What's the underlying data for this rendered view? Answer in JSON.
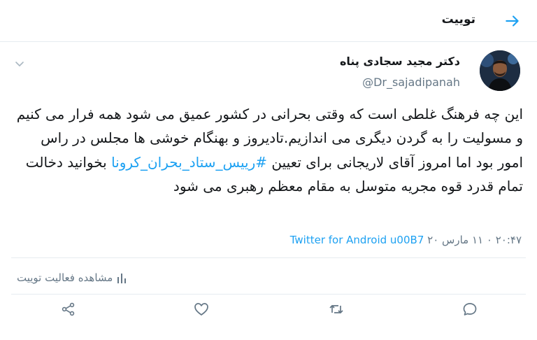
{
  "header": {
    "title": "توییت"
  },
  "tweet": {
    "author_name": "دکتر مجید سجادی پناه",
    "author_handle": "@Dr_sajadipanah",
    "text_part1": "این چه فرهنگ غلطی است که وقتی بحرانی در کشور عمیق می شود همه فرار می کنیم و مسولیت را به گردن دیگری می اندازیم.تادیروز و بهنگام خوشی ها مجلس در راس امور بود اما امروز آقای لاریجانی برای تعیین ",
    "hashtag": "#رییس_ستاد_بحران_کرونا",
    "text_part2": " بخوانید دخالت تمام قدرد قوه مجریه متوسل به مقام معظم رهبری می شود",
    "timestamp": "۲۰:۴۷ ۰ ۱۱ مارس ۲۰",
    "source": "Twitter for Android u00B7"
  },
  "activity": {
    "label": "مشاهده فعالیت توییت"
  },
  "icons": {
    "back": "arrow-right-icon",
    "caret": "chevron-down-icon",
    "share": "share-icon",
    "like": "heart-icon",
    "retweet": "retweet-icon",
    "reply": "reply-icon",
    "activity": "bar-chart-icon"
  },
  "colors": {
    "accent": "#1da1f2",
    "muted": "#657786",
    "text": "#14171a",
    "border": "#e6ecf0"
  }
}
